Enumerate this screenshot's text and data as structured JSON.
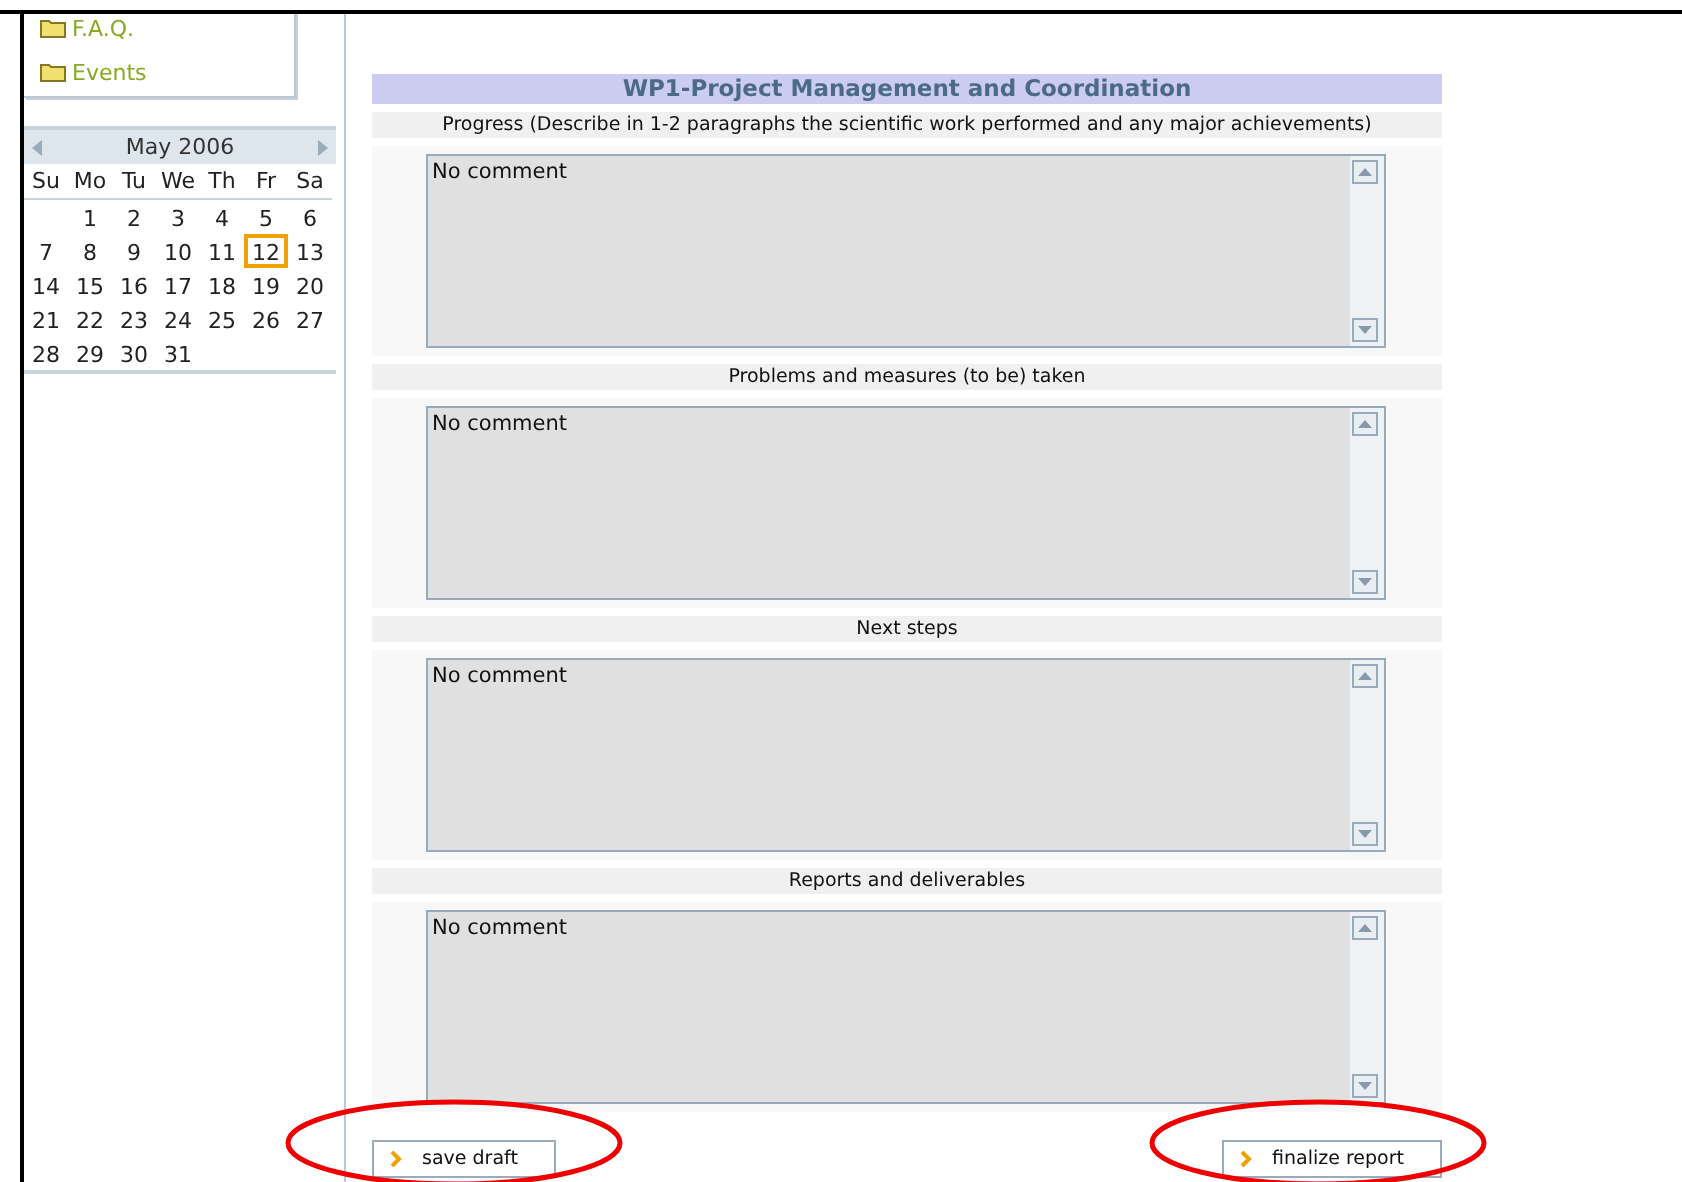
{
  "sidebar": {
    "links": [
      "F.A.Q.",
      "Events"
    ]
  },
  "calendar": {
    "month": "May 2006",
    "weekdays": [
      "Su",
      "Mo",
      "Tu",
      "We",
      "Th",
      "Fr",
      "Sa"
    ],
    "weeks": [
      [
        {
          "label": "1",
          "selected": false
        },
        {
          "label": "2",
          "selected": false
        },
        {
          "label": "3",
          "selected": false
        },
        {
          "label": "4",
          "selected": false
        },
        {
          "label": "5",
          "selected": false
        },
        {
          "label": "6",
          "selected": false
        }
      ],
      [
        {
          "label": "7",
          "selected": false
        },
        {
          "label": "8",
          "selected": false
        },
        {
          "label": "9",
          "selected": false
        },
        {
          "label": "10",
          "selected": false
        },
        {
          "label": "11",
          "selected": false
        },
        {
          "label": "12",
          "selected": true
        },
        {
          "label": "13",
          "selected": false
        }
      ],
      [
        {
          "label": "14",
          "selected": false
        },
        {
          "label": "15",
          "selected": false
        },
        {
          "label": "16",
          "selected": false
        },
        {
          "label": "17",
          "selected": false
        },
        {
          "label": "18",
          "selected": false
        },
        {
          "label": "19",
          "selected": false
        },
        {
          "label": "20",
          "selected": false
        }
      ],
      [
        {
          "label": "21",
          "selected": false
        },
        {
          "label": "22",
          "selected": false
        },
        {
          "label": "23",
          "selected": false
        },
        {
          "label": "24",
          "selected": false
        },
        {
          "label": "25",
          "selected": false
        },
        {
          "label": "26",
          "selected": false
        },
        {
          "label": "27",
          "selected": false
        }
      ],
      [
        {
          "label": "28",
          "selected": false
        },
        {
          "label": "29",
          "selected": false
        },
        {
          "label": "30",
          "selected": false
        },
        {
          "label": "31",
          "selected": false
        }
      ]
    ]
  },
  "form": {
    "title": "WP1-Project Management and Coordination",
    "sections": [
      {
        "label": "Progress (Describe in 1-2 paragraphs the scientific work performed and any major achievements)",
        "value": "No comment"
      },
      {
        "label": "Problems and measures (to be) taken",
        "value": "No comment"
      },
      {
        "label": "Next steps",
        "value": "No comment"
      },
      {
        "label": "Reports and deliverables",
        "value": "No comment"
      }
    ],
    "buttons": [
      "save draft",
      "finalize report"
    ]
  }
}
